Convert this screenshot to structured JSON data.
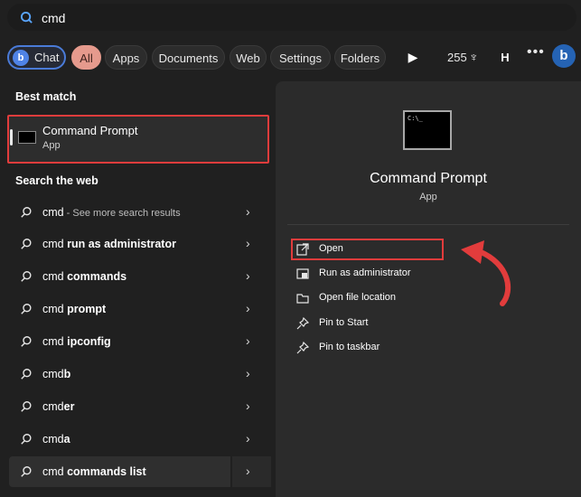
{
  "search": {
    "query": "cmd"
  },
  "filters": {
    "chat": "Chat",
    "all": "All",
    "apps": "Apps",
    "documents": "Documents",
    "web": "Web",
    "settings": "Settings",
    "folders": "Folders",
    "reward_points": "255",
    "profile_initial": "H"
  },
  "best_match": {
    "heading": "Best match",
    "title": "Command Prompt",
    "subtitle": "App"
  },
  "web_search": {
    "heading": "Search the web",
    "items": [
      {
        "prefix": "cmd",
        "bold": "",
        "suffix": " - See more search results"
      },
      {
        "prefix": "cmd ",
        "bold": "run as administrator",
        "suffix": ""
      },
      {
        "prefix": "cmd ",
        "bold": "commands",
        "suffix": ""
      },
      {
        "prefix": "cmd ",
        "bold": "prompt",
        "suffix": ""
      },
      {
        "prefix": "cmd ",
        "bold": "ipconfig",
        "suffix": ""
      },
      {
        "prefix": "cmd",
        "bold": "b",
        "suffix": ""
      },
      {
        "prefix": "cmd",
        "bold": "er",
        "suffix": ""
      },
      {
        "prefix": "cmd",
        "bold": "a",
        "suffix": ""
      },
      {
        "prefix": "cmd ",
        "bold": "commands list",
        "suffix": ""
      }
    ]
  },
  "detail": {
    "title": "Command Prompt",
    "subtitle": "App",
    "actions": [
      {
        "label": "Open",
        "icon": "open-external-icon"
      },
      {
        "label": "Run as administrator",
        "icon": "shield-run-icon"
      },
      {
        "label": "Open file location",
        "icon": "folder-icon"
      },
      {
        "label": "Pin to Start",
        "icon": "pin-icon"
      },
      {
        "label": "Pin to taskbar",
        "icon": "pin-icon"
      }
    ]
  },
  "colors": {
    "annotation_red": "#e23c3c",
    "accent_blue": "#4a7bd8",
    "all_filter": "#e59a8d"
  }
}
